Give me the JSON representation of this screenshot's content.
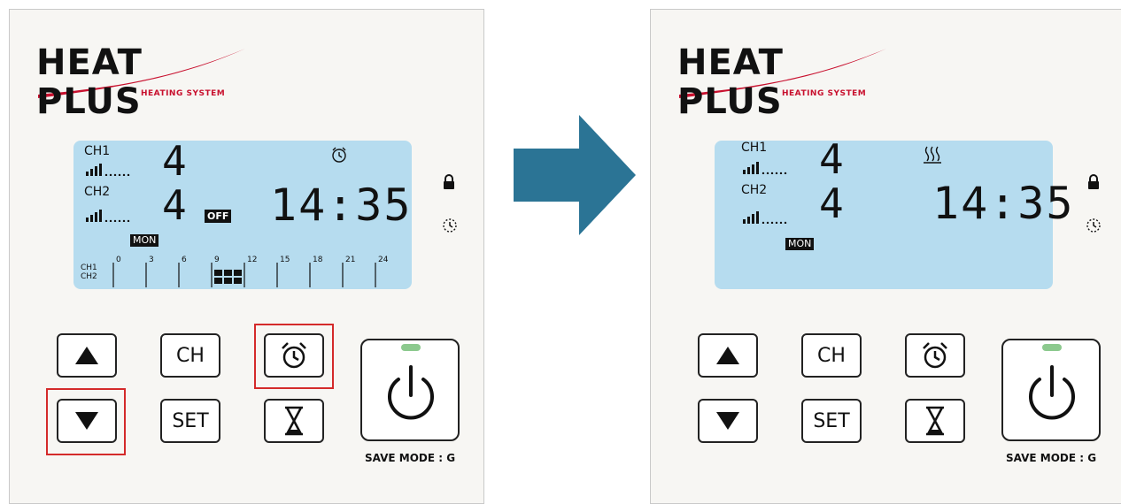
{
  "brand": {
    "name": "HEAT PLUS",
    "tagline": "HEATING SYSTEM"
  },
  "panels": [
    {
      "ch1_label": "CH1",
      "ch1_value": "4",
      "ch2_label": "CH2",
      "ch2_value": "4",
      "time": "14:35",
      "day": "MON",
      "off_badge": "OFF",
      "top_icon": "alarm-clock-icon",
      "timeline": {
        "ch_labels": [
          "CH1",
          "CH2"
        ],
        "hours": [
          "0",
          "3",
          "6",
          "9",
          "12",
          "15",
          "18",
          "21",
          "24"
        ]
      }
    },
    {
      "ch1_label": "CH1",
      "ch1_value": "4",
      "ch2_label": "CH2",
      "ch2_value": "4",
      "time": "14:35",
      "day": "MON",
      "top_icon": "heating-icon"
    }
  ],
  "buttons": {
    "up": "up-arrow-icon",
    "down": "down-arrow-icon",
    "ch": "CH",
    "set": "SET",
    "alarm": "alarm-clock-icon",
    "timer": "hourglass-icon",
    "power": "power-icon"
  },
  "save_mode": "SAVE MODE : G",
  "colors": {
    "lcd": "#b6dcef",
    "arrow": "#2b7495",
    "highlight": "#d42a2a",
    "power_led": "#8cc98e",
    "brand_red": "#c8102e"
  }
}
